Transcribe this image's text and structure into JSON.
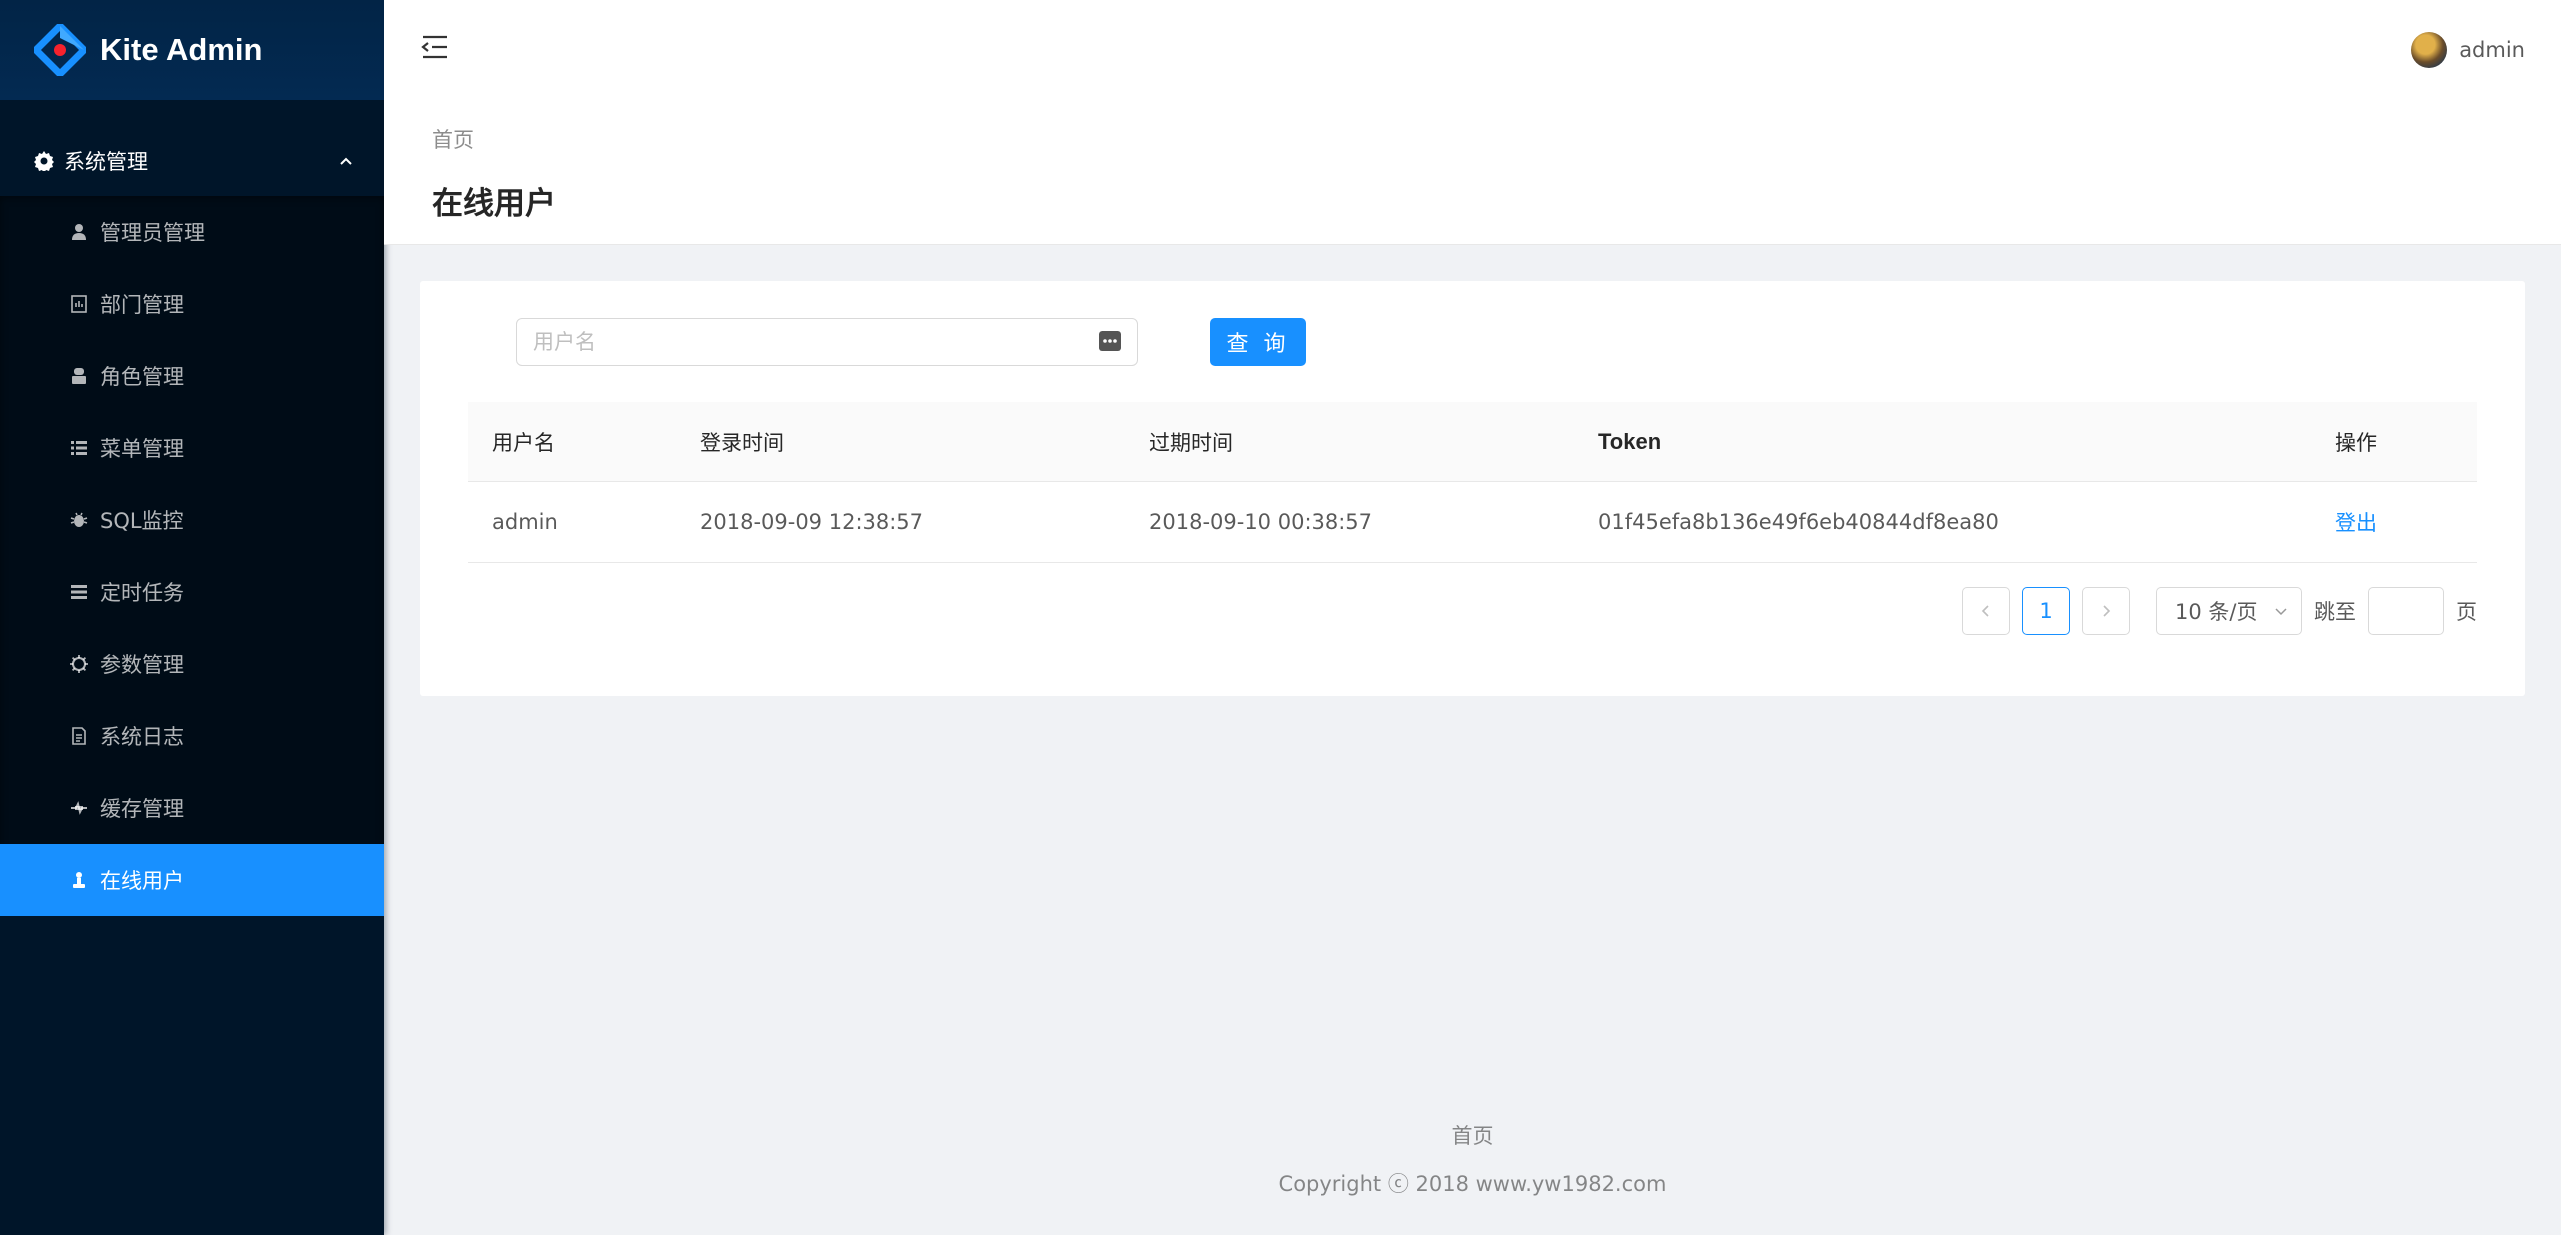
{
  "brand": {
    "name": "Kite Admin"
  },
  "sidebar": {
    "group": {
      "label": "系统管理",
      "icon": "gear-icon"
    },
    "items": [
      {
        "label": "管理员管理",
        "icon": "user-icon"
      },
      {
        "label": "部门管理",
        "icon": "department-icon"
      },
      {
        "label": "角色管理",
        "icon": "role-icon"
      },
      {
        "label": "菜单管理",
        "icon": "menu-list-icon"
      },
      {
        "label": "SQL监控",
        "icon": "bug-icon"
      },
      {
        "label": "定时任务",
        "icon": "task-icon"
      },
      {
        "label": "参数管理",
        "icon": "settings-icon"
      },
      {
        "label": "系统日志",
        "icon": "log-file-icon"
      },
      {
        "label": "缓存管理",
        "icon": "cache-icon"
      },
      {
        "label": "在线用户",
        "icon": "online-user-icon",
        "active": true
      }
    ]
  },
  "header": {
    "username": "admin"
  },
  "page": {
    "breadcrumb": "首页",
    "title": "在线用户"
  },
  "search": {
    "placeholder": "用户名",
    "value": "",
    "query_label": "查 询"
  },
  "table": {
    "columns": [
      "用户名",
      "登录时间",
      "过期时间",
      "Token",
      "操作"
    ],
    "rows": [
      {
        "username": "admin",
        "login_time": "2018-09-09 12:38:57",
        "expire_time": "2018-09-10 00:38:57",
        "token": "01f45efa8b136e49f6eb40844df8ea80",
        "action": "登出"
      }
    ]
  },
  "pagination": {
    "current_page": "1",
    "page_size": "10 条/页",
    "jump_label": "跳至",
    "page_suffix": "页"
  },
  "footer": {
    "link": "首页",
    "copyright": "Copyright ⓒ 2018 www.yw1982.com"
  },
  "colors": {
    "primary": "#1890ff",
    "sidebar_bg": "#001529",
    "submenu_bg": "#000c17"
  }
}
